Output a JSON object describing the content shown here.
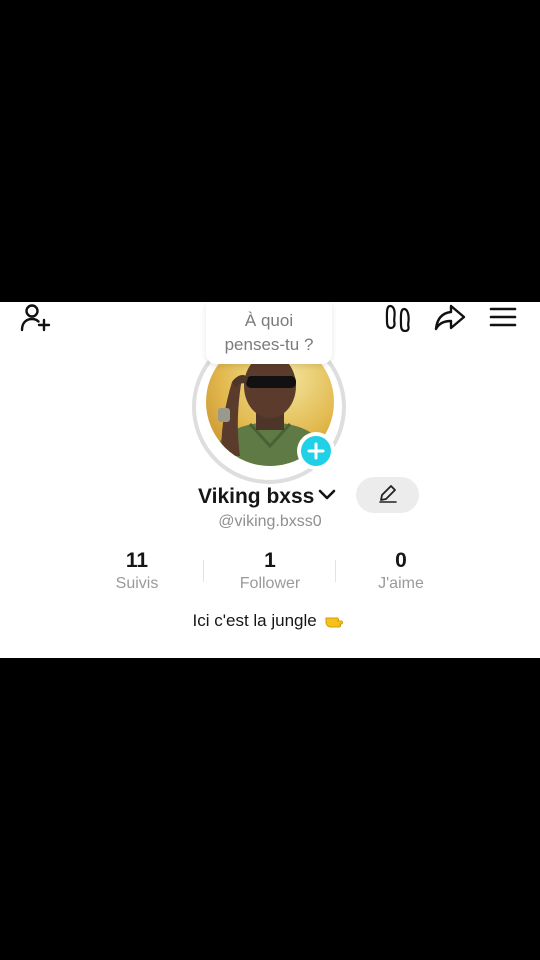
{
  "bubble": {
    "text": "À quoi penses-tu ?"
  },
  "profile": {
    "name": "Viking bxss",
    "handle": "@viking.bxss0",
    "bio": "Ici c'est la jungle"
  },
  "stats": [
    {
      "value": "11",
      "label": "Suivis"
    },
    {
      "value": "1",
      "label": "Follower"
    },
    {
      "value": "0",
      "label": "J'aime"
    }
  ],
  "colors": {
    "accent": "#1fd0e6",
    "bio_emoji": "#f5c21a"
  },
  "icons": [
    "add-friend-icon",
    "footprints-icon",
    "share-icon",
    "menu-icon",
    "chevron-down-icon",
    "edit-pencil-icon",
    "plus-icon",
    "pointing-hand-emoji"
  ]
}
